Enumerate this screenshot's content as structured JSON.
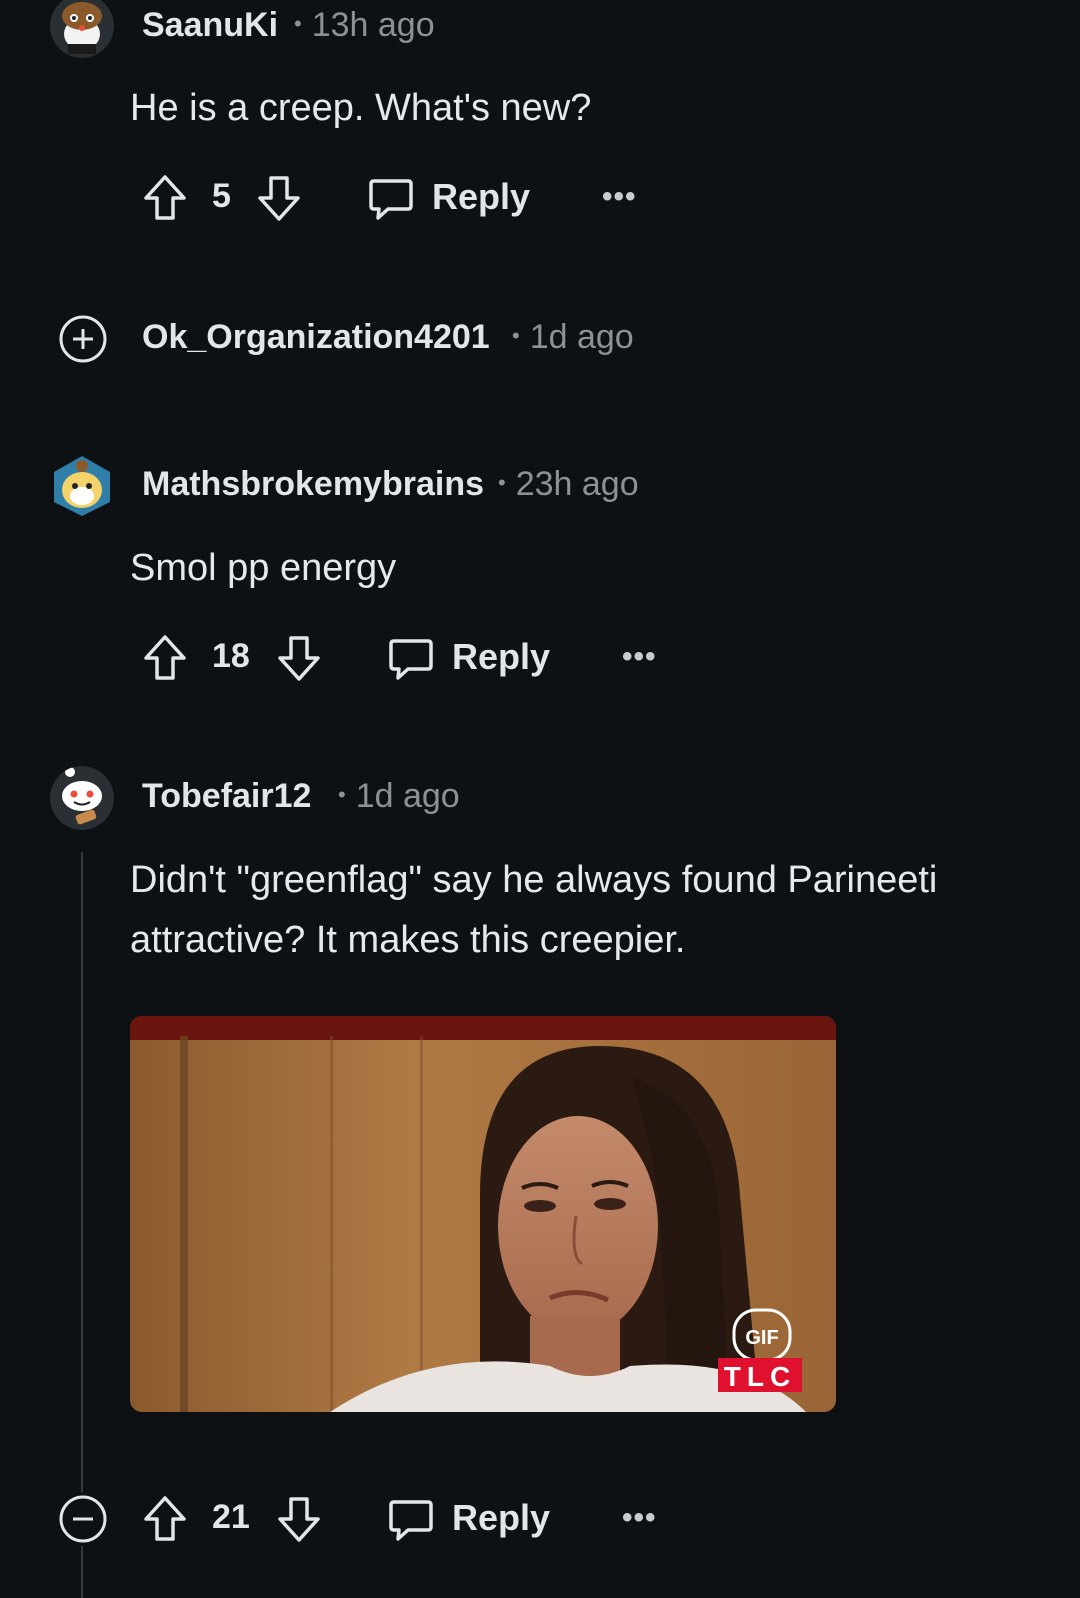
{
  "comments": [
    {
      "username": "SaanuKi",
      "separator": "•",
      "time": "13h ago",
      "text": "He is a creep. What's new?",
      "votes": "5",
      "reply_label": "Reply",
      "more_label": "•••"
    },
    {
      "username": "Ok_Organization4201",
      "separator": "•",
      "time": "1d ago",
      "collapsed": true
    },
    {
      "username": "Mathsbrokemybrains",
      "separator": "•",
      "time": "23h ago",
      "text": "Smol pp energy",
      "votes": "18",
      "reply_label": "Reply",
      "more_label": "•••"
    },
    {
      "username": "Tobefair12",
      "separator": "•",
      "time": "1d ago",
      "text_line1": "Didn't \"greenflag\" say he always found Parineeti",
      "text_line2": "attractive? It makes this creepier.",
      "gif": {
        "badge": "GIF",
        "watermark": "TLC"
      },
      "votes": "21",
      "reply_label": "Reply",
      "more_label": "•••"
    }
  ],
  "icons": {
    "upvote": "arrow-up-outline",
    "downvote": "arrow-down-outline",
    "reply": "speech-bubble",
    "expand": "plus-circle",
    "collapse": "minus-circle"
  },
  "colors": {
    "background": "#0e1114",
    "text": "#e3e6e8",
    "meta": "#8c9196",
    "thread_line": "#343a40",
    "tlc_red": "#e0102f"
  }
}
